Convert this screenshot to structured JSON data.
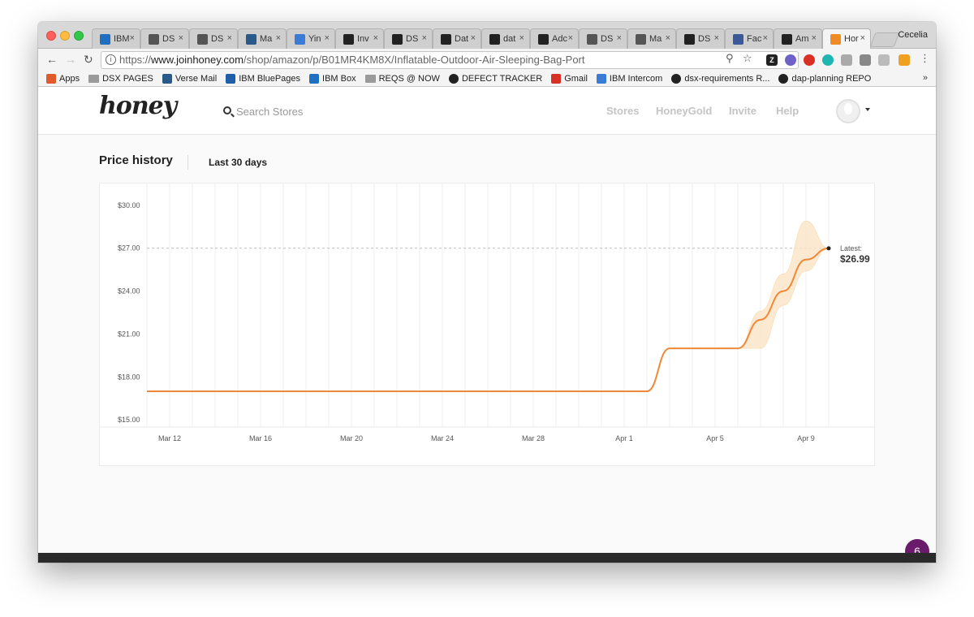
{
  "browser": {
    "profile": "Cecelia",
    "tabs": [
      {
        "label": "IBM",
        "icon": "box-icon",
        "color": "#1f70c1"
      },
      {
        "label": "DS",
        "icon": "ds-icon",
        "color": "#555555"
      },
      {
        "label": "DS",
        "icon": "ds-icon",
        "color": "#555555"
      },
      {
        "label": "Ma",
        "icon": "verse-icon",
        "color": "#2a5a8a"
      },
      {
        "label": "Yin",
        "icon": "intercom-icon",
        "color": "#3a7bd5"
      },
      {
        "label": "Inv",
        "icon": "github-icon",
        "color": "#222222"
      },
      {
        "label": "DS",
        "icon": "github-icon",
        "color": "#222222"
      },
      {
        "label": "Dat",
        "icon": "github-icon",
        "color": "#222222"
      },
      {
        "label": "dat",
        "icon": "github-icon",
        "color": "#222222"
      },
      {
        "label": "Adc",
        "icon": "github-icon",
        "color": "#222222"
      },
      {
        "label": "DS",
        "icon": "ds-icon",
        "color": "#555555"
      },
      {
        "label": "Ma",
        "icon": "ds-icon",
        "color": "#555555"
      },
      {
        "label": "DS",
        "icon": "github-icon",
        "color": "#222222"
      },
      {
        "label": "Fac",
        "icon": "facebook-icon",
        "color": "#3b5998"
      },
      {
        "label": "Am",
        "icon": "amazon-icon",
        "color": "#222222"
      },
      {
        "label": "Hor",
        "icon": "honey-icon",
        "color": "#f08a24",
        "active": true
      }
    ],
    "url_prefix": "https://",
    "url_host": "www.joinhoney.com",
    "url_path": "/shop/amazon/p/B01MR4KM8X/Inflatable-Outdoor-Air-Sleeping-Bag-Port",
    "bookmarks": [
      {
        "label": "Apps",
        "icon": "apps-grid-icon"
      },
      {
        "label": "DSX PAGES",
        "icon": "folder-icon"
      },
      {
        "label": "Verse Mail",
        "icon": "verse-icon"
      },
      {
        "label": "IBM BluePages",
        "icon": "bluepages-icon"
      },
      {
        "label": "IBM Box",
        "icon": "box-icon"
      },
      {
        "label": "REQS @ NOW",
        "icon": "folder-icon"
      },
      {
        "label": "DEFECT TRACKER",
        "icon": "github-icon"
      },
      {
        "label": "Gmail",
        "icon": "gmail-icon"
      },
      {
        "label": "IBM Intercom",
        "icon": "intercom-icon"
      },
      {
        "label": "dsx-requirements R...",
        "icon": "github-icon"
      },
      {
        "label": "dap-planning REPO",
        "icon": "github-icon"
      }
    ],
    "bookmarks_more": "»"
  },
  "site": {
    "logo": "honey",
    "search_placeholder": "Search Stores",
    "nav": [
      "Stores",
      "HoneyGold",
      "Invite",
      "Help"
    ]
  },
  "price_history": {
    "title": "Price history",
    "range": "Last 30 days",
    "latest_label": "Latest:",
    "latest_value": "$26.99"
  },
  "chart_data": {
    "type": "line",
    "x": [
      "Mar 11",
      "Mar 12",
      "Mar 13",
      "Mar 14",
      "Mar 15",
      "Mar 16",
      "Mar 17",
      "Mar 18",
      "Mar 19",
      "Mar 20",
      "Mar 21",
      "Mar 22",
      "Mar 23",
      "Mar 24",
      "Mar 25",
      "Mar 26",
      "Mar 27",
      "Mar 28",
      "Mar 29",
      "Mar 30",
      "Mar 31",
      "Apr 1",
      "Apr 2",
      "Apr 3",
      "Apr 4",
      "Apr 5",
      "Apr 6",
      "Apr 7",
      "Apr 8",
      "Apr 9",
      "Apr 10"
    ],
    "series": [
      {
        "values": [
          17.0,
          17.0,
          17.0,
          17.0,
          17.0,
          17.0,
          17.0,
          17.0,
          17.0,
          17.0,
          17.0,
          17.0,
          17.0,
          17.0,
          17.0,
          17.0,
          17.0,
          17.0,
          17.0,
          17.0,
          17.0,
          17.0,
          17.0,
          20.0,
          20.0,
          20.0,
          20.0,
          22.0,
          24.0,
          26.2,
          26.99
        ]
      }
    ],
    "band_upper": [
      17.0,
      17.0,
      17.0,
      17.0,
      17.0,
      17.0,
      17.0,
      17.0,
      17.0,
      17.0,
      17.0,
      17.0,
      17.0,
      17.0,
      17.0,
      17.0,
      17.0,
      17.0,
      17.0,
      17.0,
      17.0,
      17.0,
      17.0,
      20.0,
      20.0,
      20.0,
      20.0,
      22.6,
      25.2,
      28.9,
      26.99
    ],
    "band_lower": [
      17.0,
      17.0,
      17.0,
      17.0,
      17.0,
      17.0,
      17.0,
      17.0,
      17.0,
      17.0,
      17.0,
      17.0,
      17.0,
      17.0,
      17.0,
      17.0,
      17.0,
      17.0,
      17.0,
      17.0,
      17.0,
      17.0,
      17.0,
      20.0,
      20.0,
      20.0,
      20.0,
      20.0,
      23.0,
      25.4,
      26.99
    ],
    "x_ticks": [
      "Mar 12",
      "Mar 16",
      "Mar 20",
      "Mar 24",
      "Mar 28",
      "Apr 1",
      "Apr 5",
      "Apr 9"
    ],
    "y_ticks": [
      "$15.00",
      "$18.00",
      "$21.00",
      "$24.00",
      "$27.00",
      "$30.00"
    ],
    "y_tick_values": [
      15,
      18,
      21,
      24,
      27,
      30
    ],
    "ylim": [
      14.5,
      30.5
    ],
    "reference_line": 27.0,
    "line_color": "#f0883a",
    "band_color": "#fbe6c6",
    "grid": true
  },
  "notifications": {
    "count": "6"
  }
}
